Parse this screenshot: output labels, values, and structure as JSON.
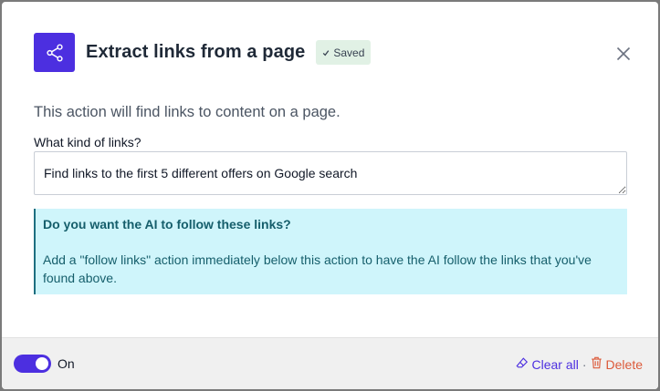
{
  "header": {
    "icon": "share-icon",
    "title": "Extract links from a page",
    "saved_badge": "Saved",
    "close_icon": "close-icon"
  },
  "description": "This action will find links to content on a page.",
  "field": {
    "label": "What kind of links?",
    "value": "Find links to the first 5 different offers on Google search"
  },
  "info": {
    "title": "Do you want the AI to follow these links?",
    "text": "Add a \"follow links\" action immediately below this action to have the AI follow the links that you've found above."
  },
  "footer": {
    "toggle_state": "On",
    "clear_all": "Clear all",
    "separator": "·",
    "delete": "Delete"
  },
  "colors": {
    "accent": "#4c2fe0",
    "saved_bg": "#e1f1e5",
    "info_bg": "#cff5fb",
    "info_text": "#155e6b",
    "delete": "#dc5a3a"
  }
}
